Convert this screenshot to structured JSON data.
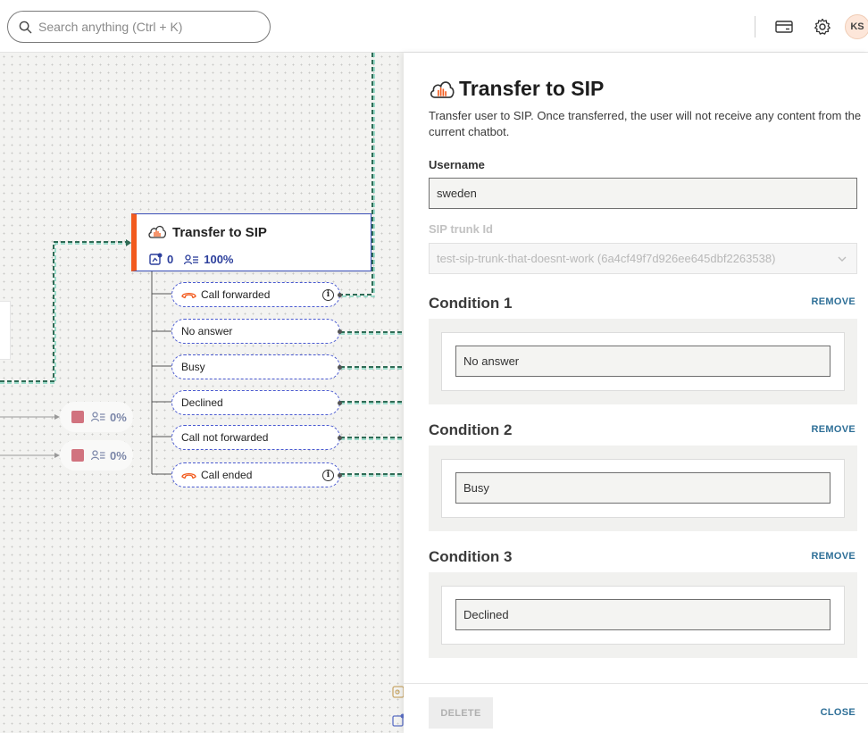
{
  "search": {
    "placeholder": "Search anything (Ctrl + K)"
  },
  "topbar": {
    "icons": [
      "card-icon",
      "gear-icon"
    ],
    "avatar_initials": "KS"
  },
  "canvas": {
    "node": {
      "title": "Transfer to SIP",
      "messages": "0",
      "users_pct": "100%"
    },
    "conditions": [
      {
        "label": "Call forwarded",
        "phone_icon": true,
        "info": "i"
      },
      {
        "label": "No answer"
      },
      {
        "label": "Busy"
      },
      {
        "label": "Declined"
      },
      {
        "label": "Call not forwarded"
      },
      {
        "label": "Call ended",
        "phone_icon": true,
        "info": "i"
      }
    ],
    "stat_nodes": [
      {
        "pct": "0%"
      },
      {
        "pct": "0%"
      }
    ]
  },
  "panel": {
    "title": "Transfer to SIP",
    "description": "Transfer user to SIP. Once transferred, the user will not receive any content from the current chatbot.",
    "username_label": "Username",
    "username_value": "sweden",
    "sip_label": "SIP trunk Id",
    "sip_value": "test-sip-trunk-that-doesnt-work (6a4cf49f7d926ee645dbf2263538)",
    "remove_label": "REMOVE",
    "conditions": [
      {
        "title": "Condition 1",
        "value": "No answer"
      },
      {
        "title": "Condition 2",
        "value": "Busy"
      },
      {
        "title": "Condition 3",
        "value": "Declined"
      }
    ],
    "delete_label": "DELETE",
    "close_label": "CLOSE"
  },
  "colors": {
    "accent_orange": "#f25a1d",
    "node_border": "#3b4fb8",
    "link_blue": "#2e6f97",
    "wire_teal": "#4caf9a"
  }
}
